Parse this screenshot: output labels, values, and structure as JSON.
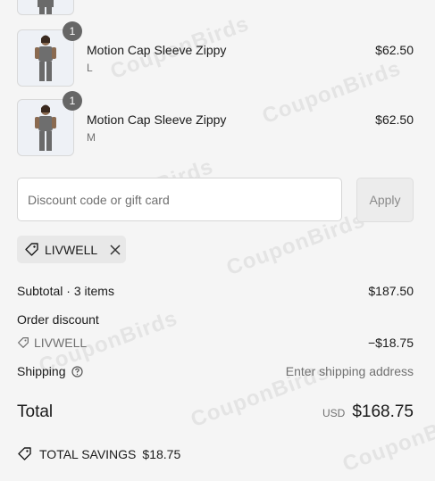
{
  "items": [
    {
      "name": "Motion Cap Sleeve Zippy",
      "variant": "L",
      "price": "$62.50",
      "quantity": "1"
    },
    {
      "name": "Motion Cap Sleeve Zippy",
      "variant": "M",
      "price": "$62.50",
      "quantity": "1"
    }
  ],
  "discount": {
    "placeholder": "Discount code or gift card",
    "apply_label": "Apply"
  },
  "applied_code": {
    "code": "LIVWELL"
  },
  "summary": {
    "subtotal_label": "Subtotal · 3 items",
    "subtotal_value": "$187.50",
    "order_discount_label": "Order discount",
    "discount_code": "LIVWELL",
    "discount_value": "−$18.75",
    "shipping_label": "Shipping",
    "shipping_value": "Enter shipping address",
    "total_label": "Total",
    "currency": "USD",
    "total_value": "$168.75",
    "savings_label": "TOTAL SAVINGS",
    "savings_value": "$18.75"
  },
  "watermark": "CouponBirds"
}
